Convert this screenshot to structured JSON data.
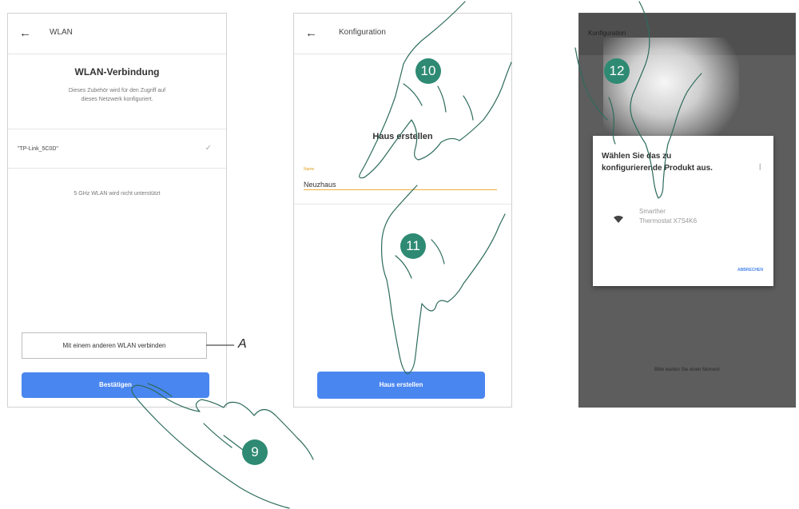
{
  "screen1": {
    "back_icon": "arrow-left-icon",
    "title": "WLAN",
    "heading": "WLAN-Verbindung",
    "description_line1": "Dieses Zubehör wird für den Zugriff auf",
    "description_line2": "dieses Netzwerk konfiguriert.",
    "network_name": "\"TP-Link_5C0D\"",
    "network_check_icon": "check-icon",
    "note": "5 GHz WLAN wird nicht unterstützt",
    "other_wlan_button": "Mit einem anderen WLAN verbinden",
    "confirm_button": "Bestätigen"
  },
  "screen2": {
    "back_icon": "arrow-left-icon",
    "title": "Konfiguration",
    "heading": "Haus erstellen",
    "field_label": "Name",
    "field_value": "Neuzhaus",
    "create_button": "Haus erstellen"
  },
  "screen3": {
    "title": "Konfiguration",
    "dialog_line1": "Wählen Sie das zu",
    "dialog_line2": "konfigurierende Produkt aus.",
    "device_icon": "wifi-icon",
    "device_line1": "Smarther",
    "device_line2": "Thermostat X7S4K6",
    "cancel_button": "ABBRECHEN",
    "bottom_hint": "Bitte warten Sie einen Moment"
  },
  "annotations": {
    "callout_a": "A",
    "step_9": "9",
    "step_10": "10",
    "step_11": "11",
    "step_12": "12",
    "badge_color": "#2e8a73",
    "button_color": "#4a86f0"
  }
}
